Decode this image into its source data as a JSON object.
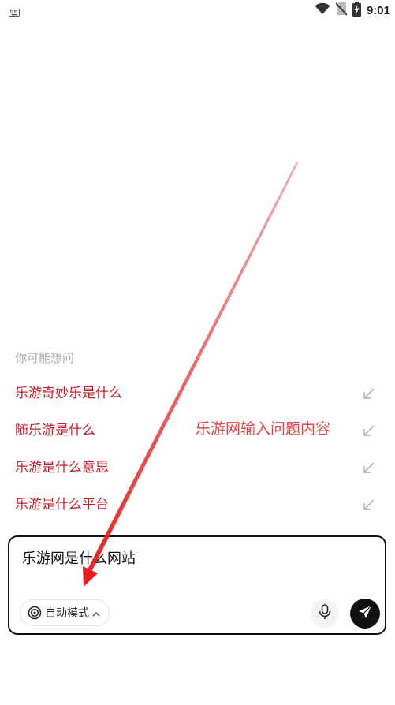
{
  "status_bar": {
    "time": "9:01",
    "icons": [
      "keyboard-icon",
      "wifi-icon",
      "no-sim-icon",
      "battery-charging-icon"
    ]
  },
  "suggestions": {
    "title": "你可能想问",
    "items": [
      {
        "label": "乐游奇妙乐是什么",
        "icon": "arrow-fill-icon"
      },
      {
        "label": "随乐游是什么",
        "icon": "arrow-fill-icon"
      },
      {
        "label": "乐游是什么意思",
        "icon": "arrow-fill-icon"
      },
      {
        "label": "乐游是什么平台",
        "icon": "arrow-fill-icon"
      }
    ]
  },
  "annotation": {
    "text": "乐游网输入问题内容",
    "color": "#e84040"
  },
  "composer": {
    "query": "乐游网是什么网站",
    "mode_label": "自动模式",
    "mode_icon": "target-icon",
    "mic_icon": "microphone-icon",
    "send_icon": "send-icon"
  },
  "colors": {
    "suggestion_text": "#c8202b",
    "muted": "#a7a7a7",
    "send_bg": "#111111"
  }
}
